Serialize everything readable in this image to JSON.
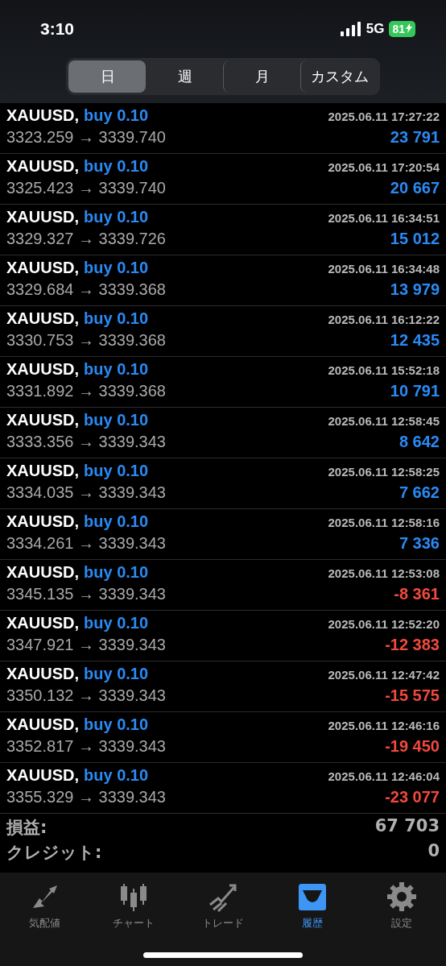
{
  "status_bar": {
    "time": "3:10",
    "network": "5G",
    "battery": "81"
  },
  "segments": [
    {
      "label": "日",
      "selected": true
    },
    {
      "label": "週",
      "selected": false
    },
    {
      "label": "月",
      "selected": false
    },
    {
      "label": "カスタム",
      "selected": false
    }
  ],
  "deals": [
    {
      "symbol": "XAUUSD,",
      "side": "buy 0.10",
      "time": "2025.06.11 17:27:22",
      "prices": "3323.259 → 3339.740",
      "profit": "23 791",
      "kind": "gain"
    },
    {
      "symbol": "XAUUSD,",
      "side": "buy 0.10",
      "time": "2025.06.11 17:20:54",
      "prices": "3325.423 → 3339.740",
      "profit": "20 667",
      "kind": "gain"
    },
    {
      "symbol": "XAUUSD,",
      "side": "buy 0.10",
      "time": "2025.06.11 16:34:51",
      "prices": "3329.327 → 3339.726",
      "profit": "15 012",
      "kind": "gain"
    },
    {
      "symbol": "XAUUSD,",
      "side": "buy 0.10",
      "time": "2025.06.11 16:34:48",
      "prices": "3329.684 → 3339.368",
      "profit": "13 979",
      "kind": "gain"
    },
    {
      "symbol": "XAUUSD,",
      "side": "buy 0.10",
      "time": "2025.06.11 16:12:22",
      "prices": "3330.753 → 3339.368",
      "profit": "12 435",
      "kind": "gain"
    },
    {
      "symbol": "XAUUSD,",
      "side": "buy 0.10",
      "time": "2025.06.11 15:52:18",
      "prices": "3331.892 → 3339.368",
      "profit": "10 791",
      "kind": "gain"
    },
    {
      "symbol": "XAUUSD,",
      "side": "buy 0.10",
      "time": "2025.06.11 12:58:45",
      "prices": "3333.356 → 3339.343",
      "profit": "8 642",
      "kind": "gain"
    },
    {
      "symbol": "XAUUSD,",
      "side": "buy 0.10",
      "time": "2025.06.11 12:58:25",
      "prices": "3334.035 → 3339.343",
      "profit": "7 662",
      "kind": "gain"
    },
    {
      "symbol": "XAUUSD,",
      "side": "buy 0.10",
      "time": "2025.06.11 12:58:16",
      "prices": "3334.261 → 3339.343",
      "profit": "7 336",
      "kind": "gain"
    },
    {
      "symbol": "XAUUSD,",
      "side": "buy 0.10",
      "time": "2025.06.11 12:53:08",
      "prices": "3345.135 → 3339.343",
      "profit": "-8 361",
      "kind": "loss"
    },
    {
      "symbol": "XAUUSD,",
      "side": "buy 0.10",
      "time": "2025.06.11 12:52:20",
      "prices": "3347.921 → 3339.343",
      "profit": "-12 383",
      "kind": "loss"
    },
    {
      "symbol": "XAUUSD,",
      "side": "buy 0.10",
      "time": "2025.06.11 12:47:42",
      "prices": "3350.132 → 3339.343",
      "profit": "-15 575",
      "kind": "loss"
    },
    {
      "symbol": "XAUUSD,",
      "side": "buy 0.10",
      "time": "2025.06.11 12:46:16",
      "prices": "3352.817 → 3339.343",
      "profit": "-19 450",
      "kind": "loss"
    },
    {
      "symbol": "XAUUSD,",
      "side": "buy 0.10",
      "time": "2025.06.11 12:46:04",
      "prices": "3355.329 → 3339.343",
      "profit": "-23 077",
      "kind": "loss"
    }
  ],
  "summary": [
    {
      "label": "損益:",
      "value": "67 703"
    },
    {
      "label": "クレジット:",
      "value": "0"
    }
  ],
  "tab_bar": [
    {
      "label": "気配値",
      "kind": "quotes",
      "selected": false
    },
    {
      "label": "チャート",
      "kind": "chart",
      "selected": false
    },
    {
      "label": "トレード",
      "kind": "trade",
      "selected": false
    },
    {
      "label": "履歴",
      "kind": "history",
      "selected": true
    },
    {
      "label": "設定",
      "kind": "settings",
      "selected": false
    }
  ]
}
